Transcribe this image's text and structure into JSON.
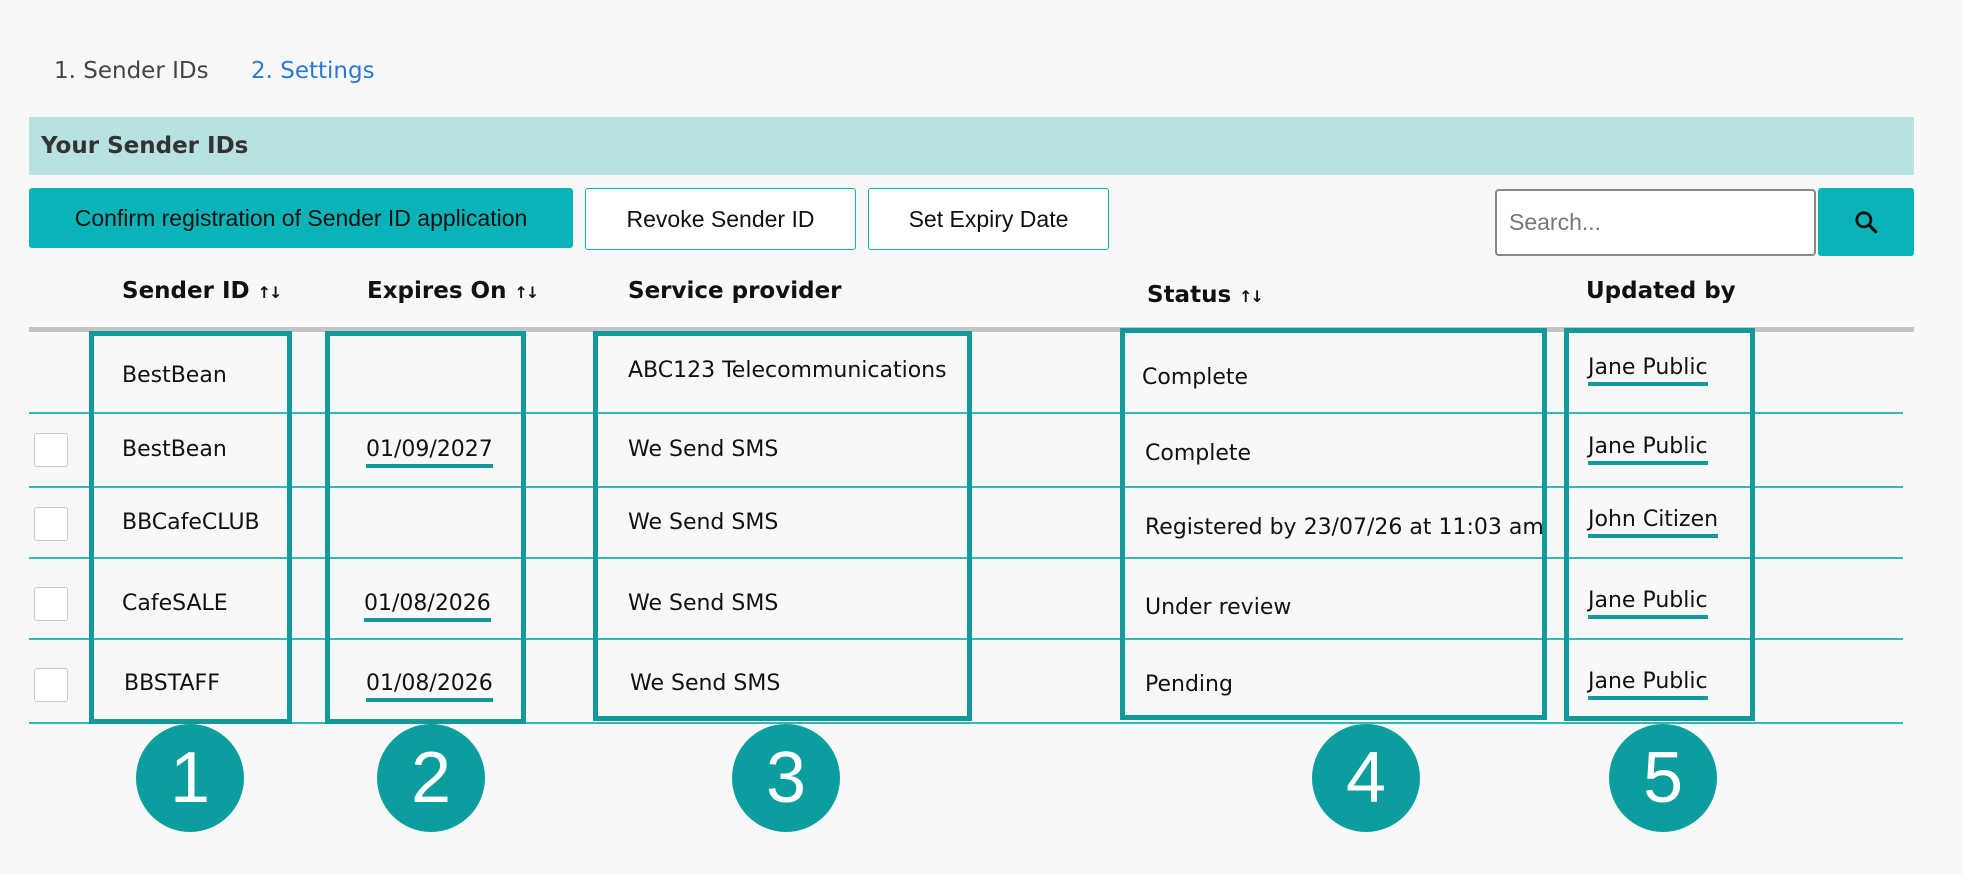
{
  "tabs": [
    "1. Sender IDs",
    "2. Settings"
  ],
  "section_title": "Your Sender IDs",
  "toolbar": {
    "confirm_label": "Confirm registration of Sender ID application",
    "revoke_label": "Revoke Sender ID",
    "expiry_label": "Set Expiry Date"
  },
  "search": {
    "placeholder": "Search...",
    "icon": "search-icon"
  },
  "columns": {
    "sender_id": "Sender ID",
    "expires_on": "Expires On",
    "service_provider": "Service provider",
    "status": "Status",
    "updated_by": "Updated by",
    "sort_glyph": "↑↓"
  },
  "rows": [
    {
      "sender_id": "BestBean",
      "expires_on": "",
      "provider": "ABC123 Telecommunications",
      "status": "Complete",
      "updated_by": "Jane Public"
    },
    {
      "sender_id": "BestBean",
      "expires_on": "01/09/2027",
      "provider": "We Send SMS",
      "status": "Complete",
      "updated_by": "Jane Public"
    },
    {
      "sender_id": "BBCafeCLUB",
      "expires_on": "",
      "provider": "We Send SMS",
      "status": "Registered by 23/07/26 at 11:03 am",
      "updated_by": "John Citizen"
    },
    {
      "sender_id": "CafeSALE",
      "expires_on": "01/08/2026",
      "provider": "We Send SMS",
      "status": "Under review",
      "updated_by": "Jane Public"
    },
    {
      "sender_id": "BBSTAFF",
      "expires_on": "01/08/2026",
      "provider": "We Send SMS",
      "status": "Pending",
      "updated_by": "Jane Public"
    }
  ],
  "callouts": [
    "1",
    "2",
    "3",
    "4",
    "5"
  ],
  "colors": {
    "accent": "#0ab3b7",
    "highlight": "#14999a",
    "header_band": "#b8e2e1"
  }
}
